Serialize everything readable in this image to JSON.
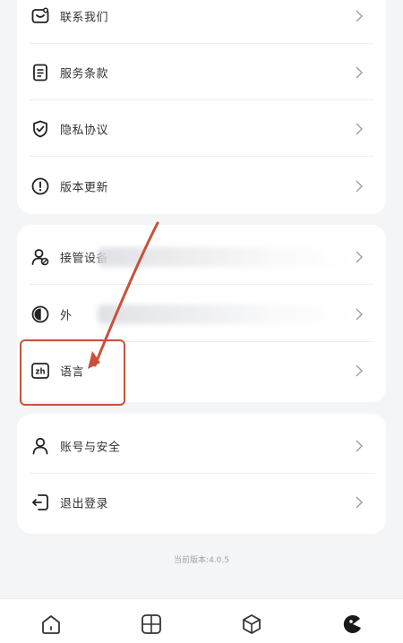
{
  "about_section": {
    "items": [
      {
        "label": "联系我们",
        "icon": "contact-icon"
      },
      {
        "label": "服务条款",
        "icon": "terms-icon"
      },
      {
        "label": "隐私协议",
        "icon": "privacy-shield-icon"
      },
      {
        "label": "版本更新",
        "icon": "update-info-icon"
      }
    ]
  },
  "prefs_section": {
    "items": [
      {
        "label": "接管设备",
        "icon": "user-takeover-icon"
      },
      {
        "label": "外",
        "icon": "appearance-icon"
      },
      {
        "label": "语言",
        "icon": "language-icon"
      }
    ]
  },
  "account_section": {
    "items": [
      {
        "label": "账号与安全",
        "icon": "user-icon"
      },
      {
        "label": "退出登录",
        "icon": "logout-icon"
      }
    ]
  },
  "version_text": "当前版本:4.0.5",
  "tabbar": {
    "tabs": [
      {
        "icon": "home-icon"
      },
      {
        "icon": "grid-icon"
      },
      {
        "icon": "box-icon"
      },
      {
        "icon": "profile-logo-icon",
        "active": true
      }
    ]
  },
  "colors": {
    "accent": "#1a1a1a",
    "annotation": "#c9513a",
    "background": "#f4f5f7"
  }
}
